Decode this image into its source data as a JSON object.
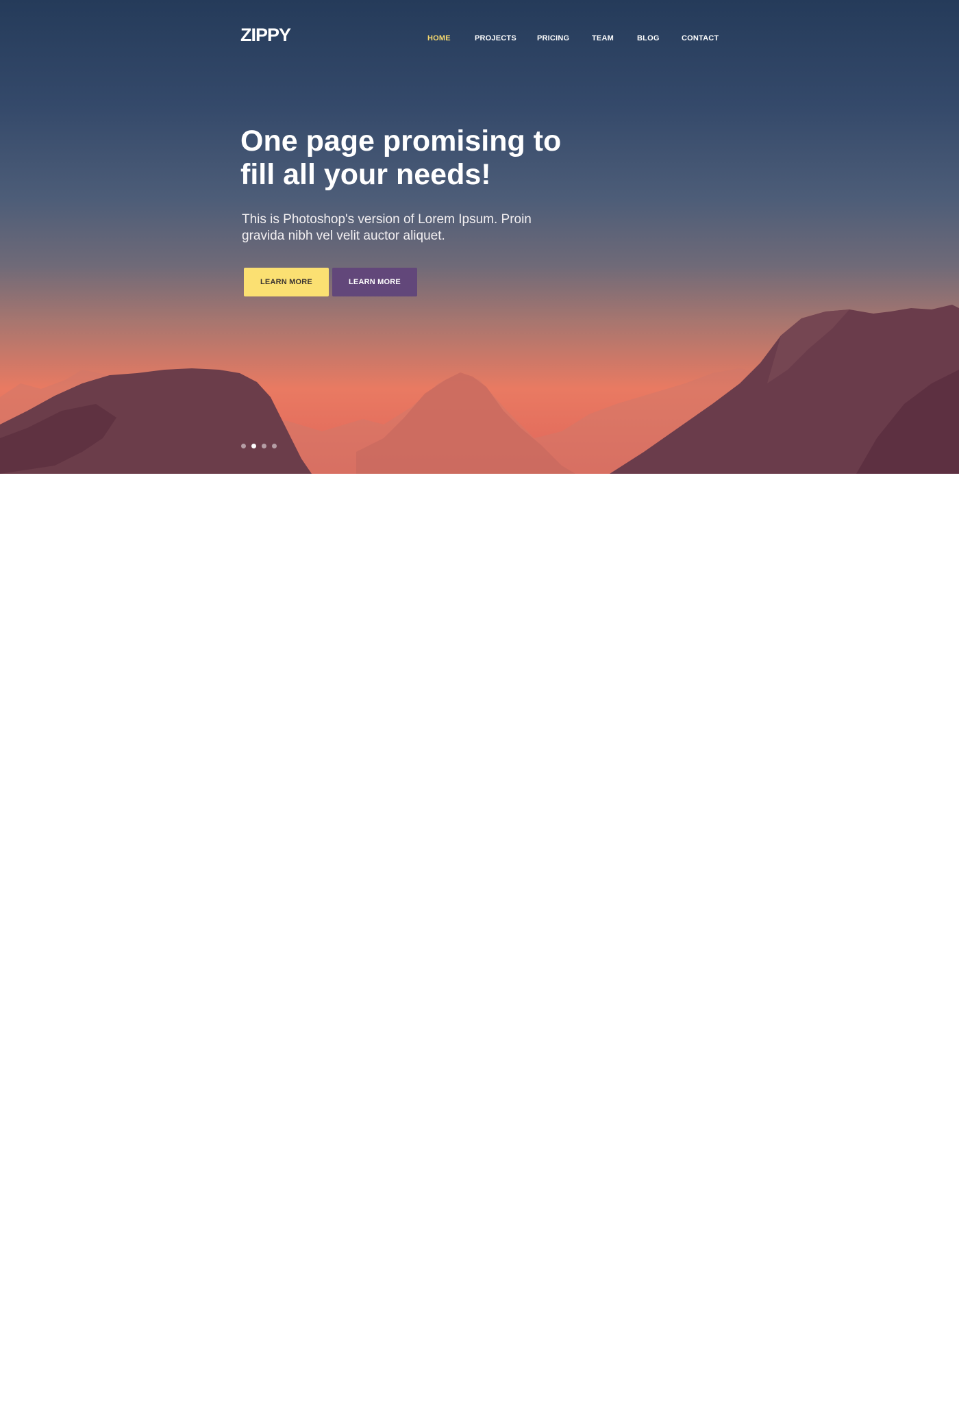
{
  "header": {
    "logo": "ZIPPY",
    "nav": [
      {
        "label": "HOME",
        "active": true
      },
      {
        "label": "PROJECTS",
        "active": false
      },
      {
        "label": "PRICING",
        "active": false
      },
      {
        "label": "TEAM",
        "active": false
      },
      {
        "label": "BLOG",
        "active": false
      },
      {
        "label": "CONTACT",
        "active": false
      }
    ]
  },
  "hero": {
    "headline_line1": "One page promising to",
    "headline_line2": "fill all your needs!",
    "subtext_line1": "This is Photoshop's version  of Lorem Ipsum. Proin",
    "subtext_line2": "gravida nibh vel velit auctor aliquet.",
    "primary_button": "LEARN MORE",
    "secondary_button": "LEARN MORE",
    "slider": {
      "total": 4,
      "active_index": 1
    }
  },
  "colors": {
    "accent_yellow": "#fbe072",
    "accent_purple": "#62477a",
    "nav_active": "#f7d96e",
    "sky_top": "#253b5a",
    "horizon": "#e97a62"
  }
}
